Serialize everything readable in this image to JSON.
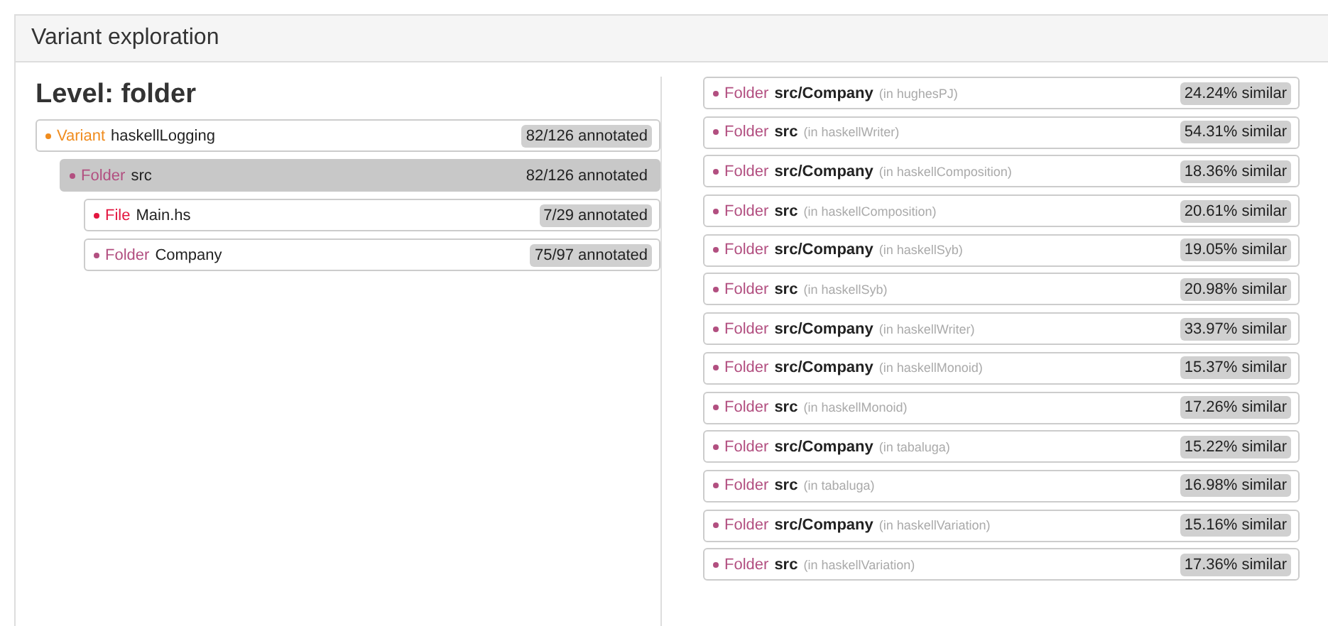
{
  "panel": {
    "title": "Variant exploration"
  },
  "level_heading": "Level: folder",
  "tree": [
    {
      "kind": "Variant",
      "color": "#f08c1e",
      "name": "haskellLogging",
      "badge": "82/126 annotated",
      "selected": false,
      "children": [
        {
          "kind": "Folder",
          "color": "#b24f80",
          "name": "src",
          "badge": "82/126 annotated",
          "selected": true,
          "children": [
            {
              "kind": "File",
              "color": "#e3153f",
              "name": "Main.hs",
              "badge": "7/29 annotated",
              "selected": false
            },
            {
              "kind": "Folder",
              "color": "#b24f80",
              "name": "Company",
              "badge": "75/97 annotated",
              "selected": false
            }
          ]
        }
      ]
    }
  ],
  "similar": [
    {
      "kind": "Folder",
      "color": "#b24f80",
      "path": "src/Company",
      "variant": "(in hughesPJ)",
      "badge": "24.24% similar"
    },
    {
      "kind": "Folder",
      "color": "#b24f80",
      "path": "src",
      "variant": "(in haskellWriter)",
      "badge": "54.31% similar"
    },
    {
      "kind": "Folder",
      "color": "#b24f80",
      "path": "src/Company",
      "variant": "(in haskellComposition)",
      "badge": "18.36% similar"
    },
    {
      "kind": "Folder",
      "color": "#b24f80",
      "path": "src",
      "variant": "(in haskellComposition)",
      "badge": "20.61% similar"
    },
    {
      "kind": "Folder",
      "color": "#b24f80",
      "path": "src/Company",
      "variant": "(in haskellSyb)",
      "badge": "19.05% similar"
    },
    {
      "kind": "Folder",
      "color": "#b24f80",
      "path": "src",
      "variant": "(in haskellSyb)",
      "badge": "20.98% similar"
    },
    {
      "kind": "Folder",
      "color": "#b24f80",
      "path": "src/Company",
      "variant": "(in haskellWriter)",
      "badge": "33.97% similar"
    },
    {
      "kind": "Folder",
      "color": "#b24f80",
      "path": "src/Company",
      "variant": "(in haskellMonoid)",
      "badge": "15.37% similar"
    },
    {
      "kind": "Folder",
      "color": "#b24f80",
      "path": "src",
      "variant": "(in haskellMonoid)",
      "badge": "17.26% similar"
    },
    {
      "kind": "Folder",
      "color": "#b24f80",
      "path": "src/Company",
      "variant": "(in tabaluga)",
      "badge": "15.22% similar"
    },
    {
      "kind": "Folder",
      "color": "#b24f80",
      "path": "src",
      "variant": "(in tabaluga)",
      "badge": "16.98% similar"
    },
    {
      "kind": "Folder",
      "color": "#b24f80",
      "path": "src/Company",
      "variant": "(in haskellVariation)",
      "badge": "15.16% similar"
    },
    {
      "kind": "Folder",
      "color": "#b24f80",
      "path": "src",
      "variant": "(in haskellVariation)",
      "badge": "17.36% similar"
    }
  ]
}
